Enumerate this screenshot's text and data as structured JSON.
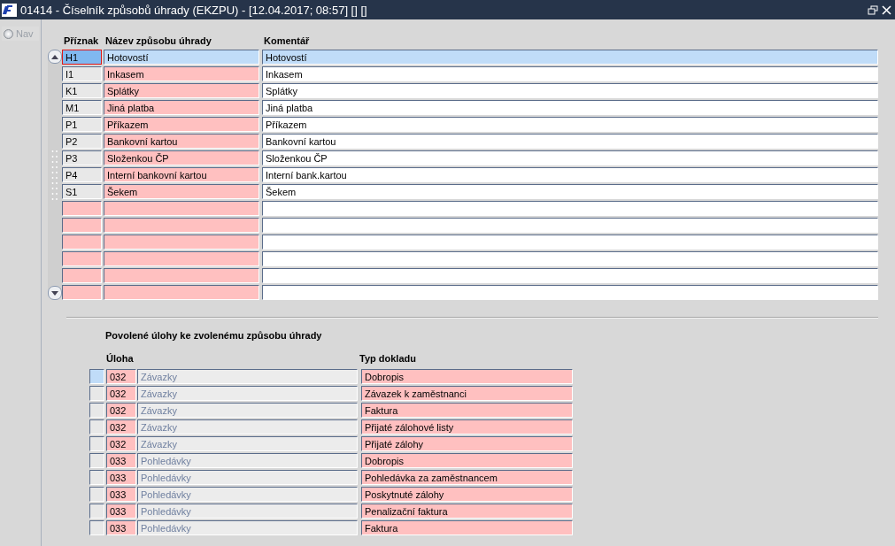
{
  "window": {
    "title": "01414 - Číselník způsobů úhrady (EKZPU) - [12.04.2017; 08:57] [] []"
  },
  "sidebar": {
    "nav": {
      "label": "Nav",
      "checked": false,
      "disabled": true
    }
  },
  "table": {
    "columns": [
      "Příznak",
      "Název způsobu úhrady",
      "Komentář"
    ],
    "rows": [
      {
        "selected": true,
        "focused": true,
        "code": "H1",
        "name": "Hotovostí",
        "comment": "Hotovostí"
      },
      {
        "selected": false,
        "focused": false,
        "code": "I1",
        "name": "Inkasem",
        "comment": "Inkasem"
      },
      {
        "selected": false,
        "focused": false,
        "code": "K1",
        "name": "Splátky",
        "comment": "Splátky"
      },
      {
        "selected": false,
        "focused": false,
        "code": "M1",
        "name": "Jiná platba",
        "comment": "Jiná platba"
      },
      {
        "selected": false,
        "focused": false,
        "code": "P1",
        "name": "Příkazem",
        "comment": "Příkazem"
      },
      {
        "selected": false,
        "focused": false,
        "code": "P2",
        "name": "Bankovní kartou",
        "comment": "Bankovní kartou"
      },
      {
        "selected": false,
        "focused": false,
        "code": "P3",
        "name": "Složenkou ČP",
        "comment": "Složenkou ČP"
      },
      {
        "selected": false,
        "focused": false,
        "code": "P4",
        "name": "Interní bankovní kartou",
        "comment": "Interní bank.kartou"
      },
      {
        "selected": false,
        "focused": false,
        "code": "S1",
        "name": "Šekem",
        "comment": "Šekem"
      },
      {
        "selected": false,
        "focused": false
      },
      {
        "selected": false,
        "focused": false
      },
      {
        "selected": false,
        "focused": false
      },
      {
        "selected": false,
        "focused": false
      },
      {
        "selected": false,
        "focused": false
      },
      {
        "selected": false,
        "focused": false
      }
    ]
  },
  "tasks": {
    "title": "Povolené úlohy ke zvolenému způsobu úhrady",
    "columns": [
      "Úloha",
      "Typ dokladu"
    ],
    "rows": [
      {
        "selected": true,
        "code": "032",
        "name": "Závazky",
        "doc_type": "Dobropis"
      },
      {
        "selected": false,
        "code": "032",
        "name": "Závazky",
        "doc_type": "Závazek k zaměstnanci"
      },
      {
        "selected": false,
        "code": "032",
        "name": "Závazky",
        "doc_type": "Faktura"
      },
      {
        "selected": false,
        "code": "032",
        "name": "Závazky",
        "doc_type": "Přijaté zálohové listy"
      },
      {
        "selected": false,
        "code": "032",
        "name": "Závazky",
        "doc_type": "Přijaté zálohy"
      },
      {
        "selected": false,
        "code": "033",
        "name": "Pohledávky",
        "doc_type": "Dobropis"
      },
      {
        "selected": false,
        "code": "033",
        "name": "Pohledávky",
        "doc_type": "Pohledávka za zaměstnancem"
      },
      {
        "selected": false,
        "code": "033",
        "name": "Pohledávky",
        "doc_type": "Poskytnuté zálohy"
      },
      {
        "selected": false,
        "code": "033",
        "name": "Pohledávky",
        "doc_type": "Penalizační faktura"
      },
      {
        "selected": false,
        "code": "033",
        "name": "Pohledávky",
        "doc_type": "Faktura"
      }
    ]
  }
}
